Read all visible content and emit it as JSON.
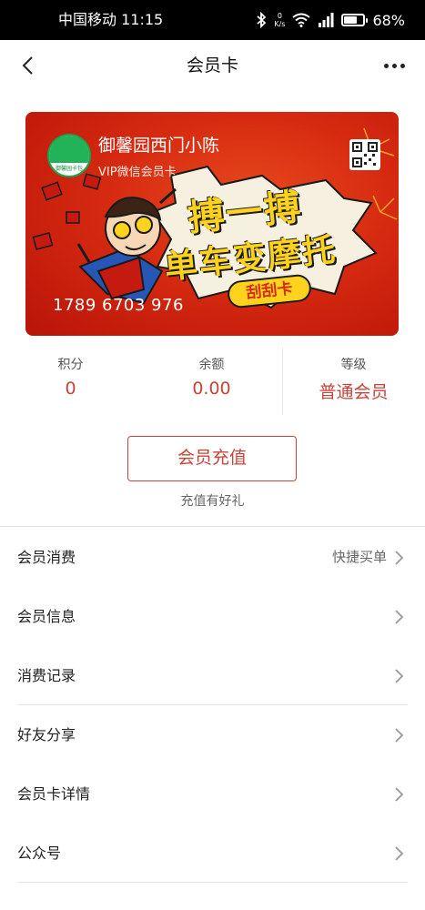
{
  "status_bar": {
    "carrier_time": "中国移动 11:15",
    "net_speed_value": "0",
    "net_speed_unit": "K/s",
    "battery": "68%",
    "battery_level": 0.68
  },
  "nav": {
    "title": "会员卡",
    "back_icon": "back-arrow-icon",
    "more_icon": "more-dots-icon"
  },
  "card": {
    "store_name": "御馨园西门小陈",
    "card_type": "VIP微信会员卡",
    "card_number": "1789 6703 976",
    "logo_text": "御馨园卡包",
    "art_line_1": "搏一搏",
    "art_line_2": "单车变摩托",
    "art_badge": "刮刮卡",
    "accent_color": "#d62a10"
  },
  "stats": {
    "points": {
      "label": "积分",
      "value": "0"
    },
    "balance": {
      "label": "余额",
      "value": "0.00"
    },
    "level": {
      "label": "等级",
      "value": "普通会员"
    }
  },
  "recharge": {
    "button_label": "会员充值",
    "tip": "充值有好礼"
  },
  "menu": {
    "items": [
      {
        "label": "会员消费",
        "extra": "快捷买单"
      },
      {
        "label": "会员信息",
        "extra": ""
      },
      {
        "label": "消费记录",
        "extra": ""
      },
      {
        "label": "好友分享",
        "extra": ""
      },
      {
        "label": "会员卡详情",
        "extra": ""
      },
      {
        "label": "公众号",
        "extra": ""
      }
    ]
  },
  "colors": {
    "accent": "#c8443a"
  }
}
